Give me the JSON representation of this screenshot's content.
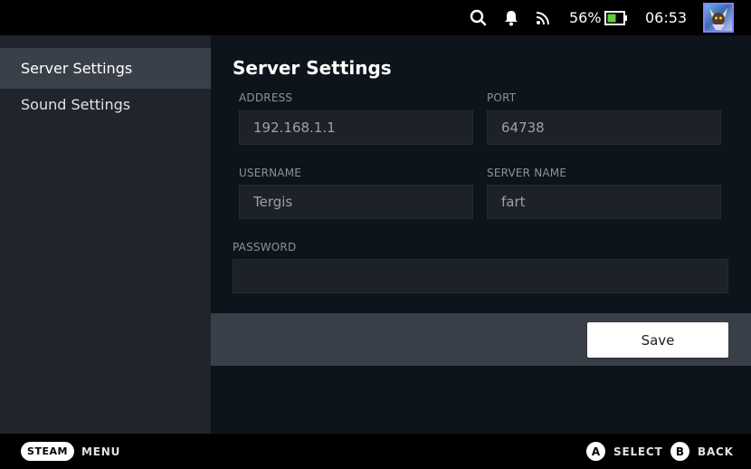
{
  "status_bar": {
    "battery_percent": "56%",
    "battery_level": 0.56,
    "time": "06:53",
    "icons": [
      "search-icon",
      "bell-icon",
      "rss-icon",
      "battery-icon",
      "avatar"
    ]
  },
  "sidebar": {
    "items": [
      {
        "label": "Server Settings",
        "active": true
      },
      {
        "label": "Sound Settings",
        "active": false
      }
    ]
  },
  "main": {
    "title": "Server Settings",
    "fields": {
      "address": {
        "label": "ADDRESS",
        "value": "192.168.1.1"
      },
      "port": {
        "label": "PORT",
        "value": "64738"
      },
      "username": {
        "label": "USERNAME",
        "value": "Tergis"
      },
      "server_name": {
        "label": "SERVER NAME",
        "value": "fart"
      },
      "password": {
        "label": "PASSWORD",
        "value": ""
      }
    },
    "save_label": "Save"
  },
  "bottom_bar": {
    "steam_label": "STEAM",
    "menu_label": "MENU",
    "a_glyph": "A",
    "select_label": "SELECT",
    "b_glyph": "B",
    "back_label": "BACK"
  },
  "colors": {
    "background": "#0e141b",
    "sidebar": "#1f242d",
    "active_item": "#3a4049",
    "field": "#1d222a",
    "battery_fill": "#5fce3b"
  }
}
